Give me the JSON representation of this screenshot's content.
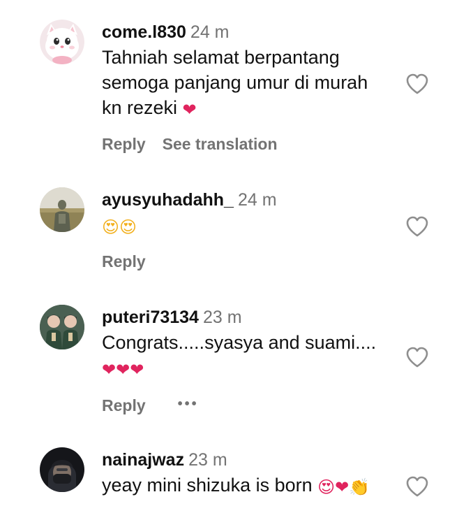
{
  "comments": [
    {
      "username": "come.l830",
      "time": "24 m",
      "text_lines": [
        "Tahniah selamat berpantang",
        "semoga panjang umur di murah",
        "kn rezeki "
      ],
      "emojis": "❤",
      "avatar_icon": "white-kitten-avatar",
      "actions": {
        "reply": "Reply",
        "translate": "See translation"
      }
    },
    {
      "username": "ayusyuhadahh_",
      "time": "24 m",
      "text_lines": [],
      "emojis": "😍😍",
      "avatar_icon": "person-in-field-avatar",
      "actions": {
        "reply": "Reply"
      }
    },
    {
      "username": "puteri73134",
      "time": "23 m",
      "text_lines": [
        "Congrats.....syasya and suami...."
      ],
      "emojis": "❤❤❤",
      "avatar_icon": "twin-children-avatar",
      "actions": {
        "reply": "Reply",
        "more": "•••"
      }
    },
    {
      "username": "nainajwaz",
      "time": "23 m",
      "text_lines": [
        "yeay mini shizuka is born "
      ],
      "emojis": "😍❤👏",
      "avatar_icon": "masked-person-avatar",
      "actions": {}
    }
  ],
  "colors": {
    "username": "#111111",
    "muted": "#737373",
    "heart_outline": "#8e8e8e",
    "emoji_red": "#e0245e"
  }
}
